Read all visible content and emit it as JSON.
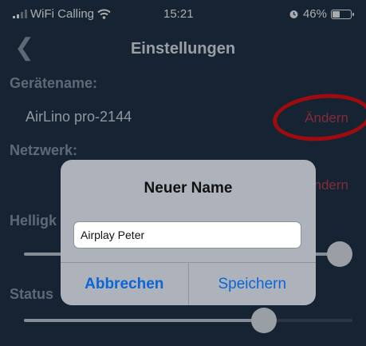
{
  "status_bar": {
    "carrier": "WiFi Calling",
    "time": "15:21",
    "battery_percent": "46%",
    "battery_level": 0.46
  },
  "nav": {
    "title": "Einstellungen"
  },
  "device": {
    "label": "Gerätename:",
    "name": "AirLino pro-2144",
    "change_label": "Ändern"
  },
  "network": {
    "label": "Netzwerk:",
    "change_label": "ndern"
  },
  "brightness": {
    "label": "Helligk",
    "level": 0.96
  },
  "status": {
    "label": "Status",
    "level": 0.73
  },
  "dialog": {
    "title": "Neuer Name",
    "input_value": "Airplay Peter",
    "cancel_label": "Abbrechen",
    "save_label": "Speichern"
  }
}
